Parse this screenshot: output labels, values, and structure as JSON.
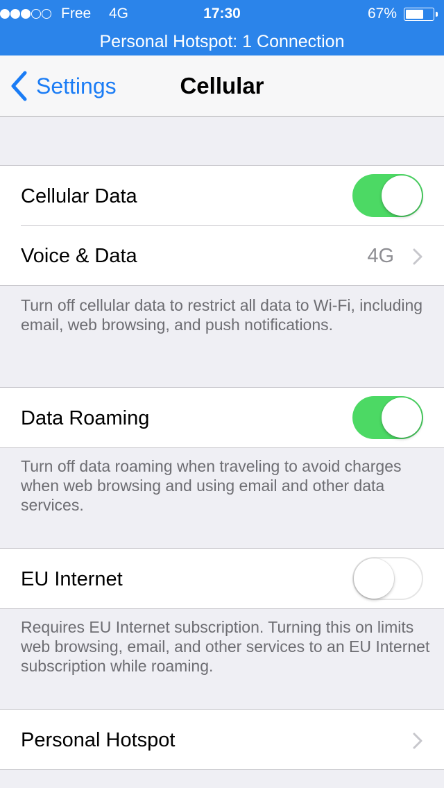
{
  "status_bar": {
    "carrier": "Free",
    "network": "4G",
    "time": "17:30",
    "battery_percent": "67%",
    "battery_level": 0.67,
    "signal_bars": 3,
    "signal_total": 5,
    "hotspot_banner": "Personal Hotspot: 1 Connection",
    "bg_color": "#2b84ea"
  },
  "nav": {
    "back_label": "Settings",
    "title": "Cellular",
    "back_icon": "chevron-left-icon",
    "accent_color": "#1a7cf5"
  },
  "cellular": {
    "cellular_data_label": "Cellular Data",
    "cellular_data_on": true,
    "voice_data_label": "Voice & Data",
    "voice_data_value": "4G",
    "footer": "Turn off cellular data to restrict all data to Wi-Fi, including email, web browsing, and push notifications."
  },
  "roaming": {
    "label": "Data Roaming",
    "on": true,
    "footer": "Turn off data roaming when traveling to avoid charges when web browsing and using email and other data services."
  },
  "eu": {
    "label": "EU Internet",
    "on": false,
    "footer": "Requires EU Internet subscription. Turning this on limits web browsing, email, and other services to an EU Internet subscription while roaming."
  },
  "hotspot": {
    "label": "Personal Hotspot"
  },
  "colors": {
    "toggle_on": "#4cd964",
    "background": "#efeff4"
  }
}
